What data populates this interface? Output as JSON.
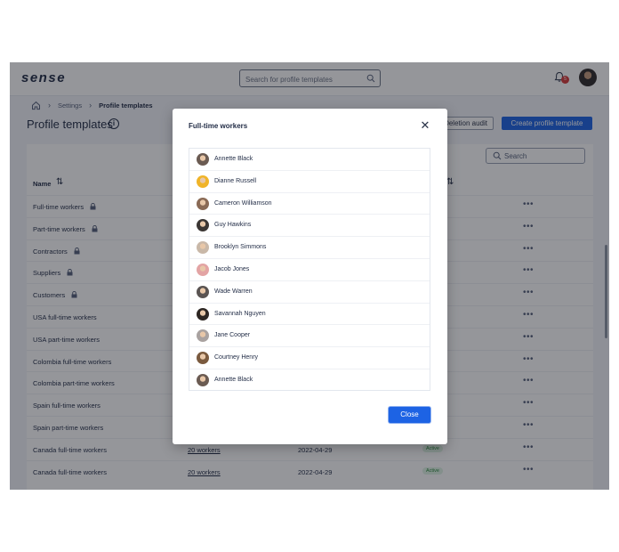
{
  "app": {
    "logo": "sense",
    "search_placeholder": "Search for profile templates",
    "notifications_count": "5"
  },
  "breadcrumb": {
    "item1": "Settings",
    "item2": "Profile templates"
  },
  "page": {
    "title": "Profile templates",
    "audit_button": "Deletion audit",
    "create_button": "Create profile template"
  },
  "table": {
    "search_placeholder": "Search",
    "col_name": "Name",
    "rows": [
      {
        "name": "Full-time workers",
        "locked": true
      },
      {
        "name": "Part-time workers",
        "locked": true
      },
      {
        "name": "Contractors",
        "locked": true
      },
      {
        "name": "Suppliers",
        "locked": true
      },
      {
        "name": "Customers",
        "locked": true
      },
      {
        "name": "USA full-time workers",
        "locked": false
      },
      {
        "name": "USA part-time workers",
        "locked": false
      },
      {
        "name": "Colombia full-time workers",
        "locked": false
      },
      {
        "name": "Colombia part-time workers",
        "locked": false
      },
      {
        "name": "Spain full-time workers",
        "locked": false
      },
      {
        "name": "Spain part-time workers",
        "locked": false
      },
      {
        "name": "Canada full-time workers",
        "locked": false,
        "workers": "20 workers",
        "date": "2022-04-29",
        "status": "Active"
      },
      {
        "name": "Canada full-time workers",
        "locked": false,
        "workers": "20 workers",
        "date": "2022-04-29",
        "status": "Active"
      }
    ]
  },
  "modal": {
    "title": "Full-time workers",
    "close_button": "Close",
    "workers": [
      {
        "name": "Annette Black",
        "color": "#6b5b52"
      },
      {
        "name": "Dianne Russell",
        "color": "#f0b429"
      },
      {
        "name": "Cameron Williamson",
        "color": "#8a6a55"
      },
      {
        "name": "Guy Hawkins",
        "color": "#3b3633"
      },
      {
        "name": "Brooklyn Simmons",
        "color": "#c9b8a8"
      },
      {
        "name": "Jacob Jones",
        "color": "#e3a4a4"
      },
      {
        "name": "Wade Warren",
        "color": "#5a5452"
      },
      {
        "name": "Savannah Nguyen",
        "color": "#2d2622"
      },
      {
        "name": "Jane Cooper",
        "color": "#a9a2a0"
      },
      {
        "name": "Courtney Henry",
        "color": "#7a5a3e"
      },
      {
        "name": "Annette Black",
        "color": "#6b5b52"
      }
    ]
  }
}
